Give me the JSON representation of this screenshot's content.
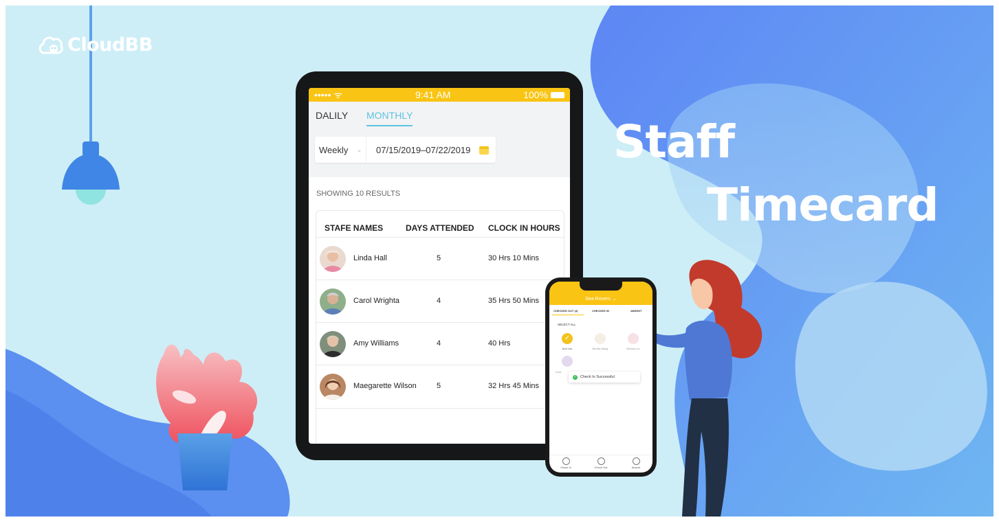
{
  "brand": {
    "name": "CloudBB"
  },
  "headline": {
    "line1": "Staff",
    "line2": "Timecard"
  },
  "tablet": {
    "status": {
      "carrier": "••••• ᯤ",
      "time": "9:41 AM",
      "battery": "100%"
    },
    "tabs": {
      "daily": "DALILY",
      "monthly": "MONTHLY"
    },
    "filter": {
      "period": "Weekly",
      "date_range": "07/15/2019–07/22/2019"
    },
    "results_label": "SHOWING 10 RESULTS",
    "table": {
      "headers": {
        "name": "STAFE NAMES",
        "days": "DAYS ATTENDED",
        "hours": "CLOCK IN HOURS"
      },
      "rows": [
        {
          "name": "Linda Hall",
          "days": "5",
          "hours": "30 Hrs 10 Mins"
        },
        {
          "name": "Carol Wrighta",
          "days": "4",
          "hours": "35 Hrs 50 Mins"
        },
        {
          "name": "Amy Williams",
          "days": "4",
          "hours": "40 Hrs"
        },
        {
          "name": "Maegarette Wilson",
          "days": "5",
          "hours": "32 Hrs 45 Mins"
        }
      ]
    }
  },
  "phone": {
    "header_title": "Sea Rovers",
    "tabs": {
      "checked_out": "CHECKED OUT (4)",
      "checked_in": "CHECKED IN",
      "absent": "ABSENT"
    },
    "select_all": "SELECT ALL",
    "students": [
      "Ana Lee",
      "Benita Wang",
      "Breana Lin",
      "Cara"
    ],
    "toast": "Check In Successful",
    "nav": [
      "Check In",
      "Check Out",
      "Absent"
    ]
  },
  "colors": {
    "accent_yellow": "#f9c413",
    "tab_blue": "#5bc3e2",
    "background": "#cdeef6",
    "blob_blue": "#5a8ff0"
  }
}
